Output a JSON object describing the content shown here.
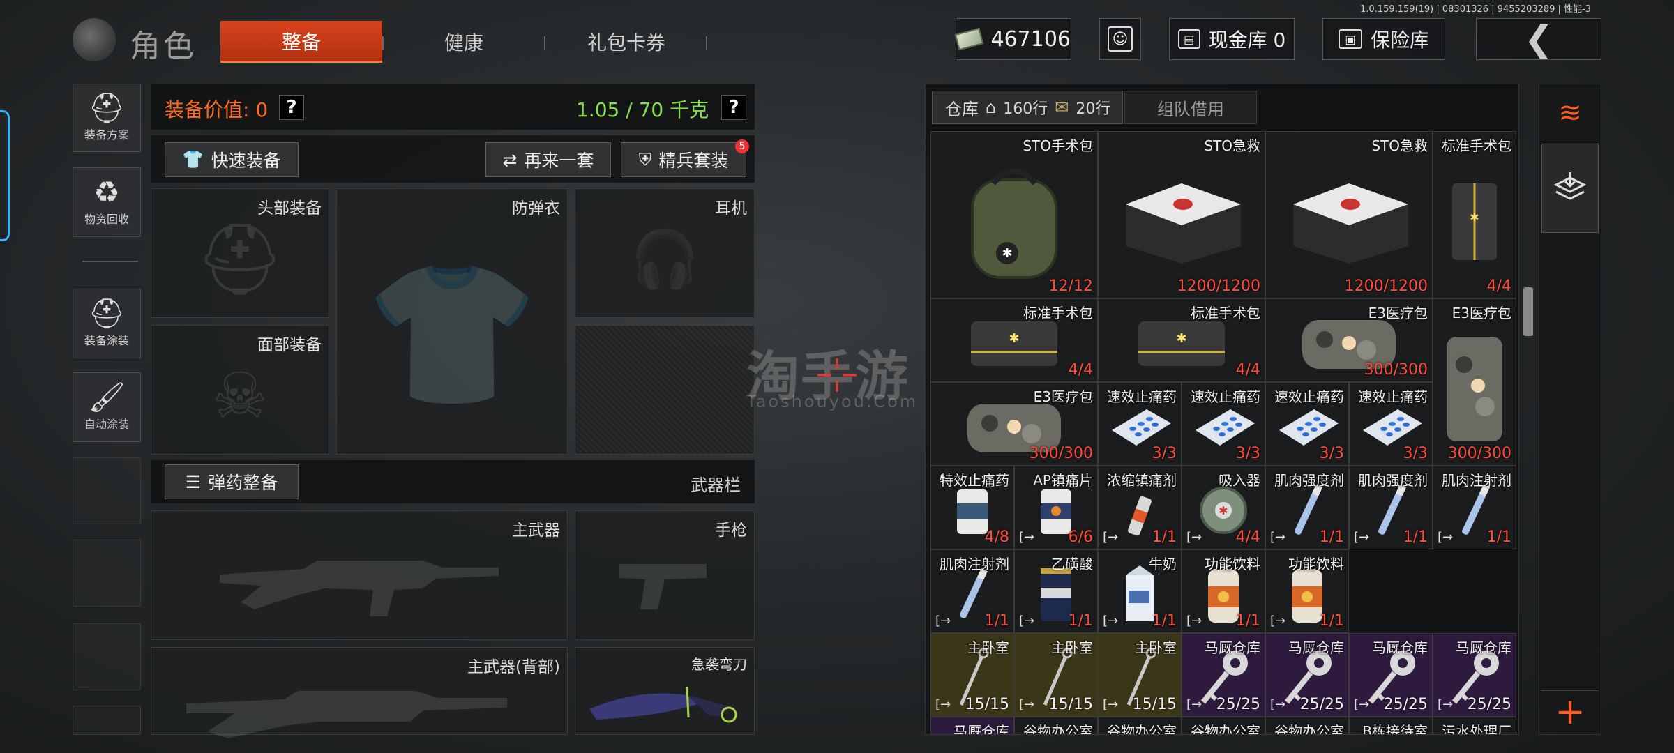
{
  "version": "1.0.159.159(19) | 08301326 | 9455203289 | 性能-3",
  "header": {
    "title": "角色",
    "tabs": [
      {
        "label": "整备",
        "active": true
      },
      {
        "label": "健康",
        "active": false
      },
      {
        "label": "礼包卡券",
        "active": false
      }
    ],
    "money": "467106",
    "cash_vault": "现金库 0",
    "safe_vault": "保险库"
  },
  "left_menu": [
    {
      "label": "装备方案",
      "icon": "helmet-plan-icon"
    },
    {
      "label": "物资回收",
      "icon": "recycle-icon"
    },
    {
      "label": "装备涂装",
      "icon": "paint-helmet-icon"
    },
    {
      "label": "自动涂装",
      "icon": "auto-paint-icon"
    }
  ],
  "equipment": {
    "value_label": "装备价值: 0",
    "weight": "1.05 / 70 千克",
    "help": "?",
    "quick_equip": "快速装备",
    "again": "再来一套",
    "elite": "精兵套装",
    "elite_badge": "5",
    "slots": {
      "head": "头部装备",
      "armor": "防弹衣",
      "ear": "耳机",
      "face": "面部装备"
    },
    "ammo": "弹药整备",
    "weapon_bar": "武器栏",
    "weapons": {
      "primary": "主武器",
      "pistol": "手枪",
      "primary_back": "主武器(背部)",
      "knife": "急袭弯刀"
    }
  },
  "watermark": {
    "main": "淘手游",
    "sub": "Taoshouyou.Com"
  },
  "warehouse": {
    "tab_label": "仓库",
    "rows": "160行",
    "rows20": "20行",
    "team_borrow": "组队借用",
    "cells": [
      {
        "name": "STO手术包",
        "count": "12/12",
        "art": "green-bag"
      },
      {
        "name": "STO急救",
        "count": "1200/1200",
        "art": "white-case"
      },
      {
        "name": "STO急救",
        "count": "1200/1200",
        "art": "white-case"
      },
      {
        "name": "标准手术包",
        "count": "4/4",
        "art": "dark-bag-tall"
      },
      {
        "name": "标准手术包",
        "count": "4/4",
        "art": "dark-bag"
      },
      {
        "name": "标准手术包",
        "count": "4/4",
        "art": "dark-bag"
      },
      {
        "name": "E3医疗包",
        "count": "300/300",
        "art": "camo-bag"
      },
      {
        "name": "E3医疗包",
        "count": "300/300",
        "art": "camo-bag-tall"
      },
      {
        "name": "E3医疗包",
        "count": "300/300",
        "art": "camo-bag"
      },
      {
        "name": "速效止痛药",
        "count": "3/3",
        "art": "pills"
      },
      {
        "name": "速效止痛药",
        "count": "3/3",
        "art": "pills"
      },
      {
        "name": "速效止痛药",
        "count": "3/3",
        "art": "pills"
      },
      {
        "name": "速效止痛药",
        "count": "3/3",
        "art": "pills"
      },
      {
        "name": "特效止痛药",
        "count": "4/8",
        "art": "jar"
      },
      {
        "name": "AP镇痛片",
        "count": "6/6",
        "art": "jar-blue"
      },
      {
        "name": "浓缩镇痛剂",
        "count": "1/1",
        "art": "spray"
      },
      {
        "name": "吸入器",
        "count": "4/4",
        "art": "inhaler"
      },
      {
        "name": "肌肉强度剂",
        "count": "1/1",
        "art": "syringe"
      },
      {
        "name": "肌肉强度剂",
        "count": "1/1",
        "art": "syringe"
      },
      {
        "name": "肌肉注射剂",
        "count": "1/1",
        "art": "syringe"
      },
      {
        "name": "肌肉注射剂",
        "count": "1/1",
        "art": "syringe"
      },
      {
        "name": "乙磺酸",
        "count": "1/1",
        "art": "can"
      },
      {
        "name": "牛奶",
        "count": "1/1",
        "art": "milk"
      },
      {
        "name": "功能饮料",
        "count": "1/1",
        "art": "drink"
      },
      {
        "name": "功能饮料",
        "count": "1/1",
        "art": "drink"
      },
      {
        "name": "主卧室",
        "count": "15/15",
        "art": "key-thin"
      },
      {
        "name": "主卧室",
        "count": "15/15",
        "art": "key-thin"
      },
      {
        "name": "主卧室",
        "count": "15/15",
        "art": "key-thin"
      },
      {
        "name": "马厩仓库",
        "count": "25/25",
        "art": "key"
      },
      {
        "name": "马厩仓库",
        "count": "25/25",
        "art": "key"
      },
      {
        "name": "马厩仓库",
        "count": "25/25",
        "art": "key"
      },
      {
        "name": "马厩仓库",
        "count": "25/25",
        "art": "key"
      },
      {
        "name": "马厩仓库",
        "count": "",
        "art": ""
      },
      {
        "name": "谷物办公室",
        "count": "",
        "art": ""
      },
      {
        "name": "谷物办公室",
        "count": "",
        "art": ""
      },
      {
        "name": "谷物办公室",
        "count": "",
        "art": ""
      },
      {
        "name": "谷物办公室",
        "count": "",
        "art": ""
      },
      {
        "name": "B栋接待室",
        "count": "",
        "art": ""
      },
      {
        "name": "污水处理厂",
        "count": "",
        "art": ""
      }
    ]
  },
  "colors": {
    "accent": "#d8431e",
    "green": "#84e04a",
    "count_red": "#ff4a3a",
    "key_yellow": "#3c3619",
    "key_purple": "#2e1a3d"
  }
}
